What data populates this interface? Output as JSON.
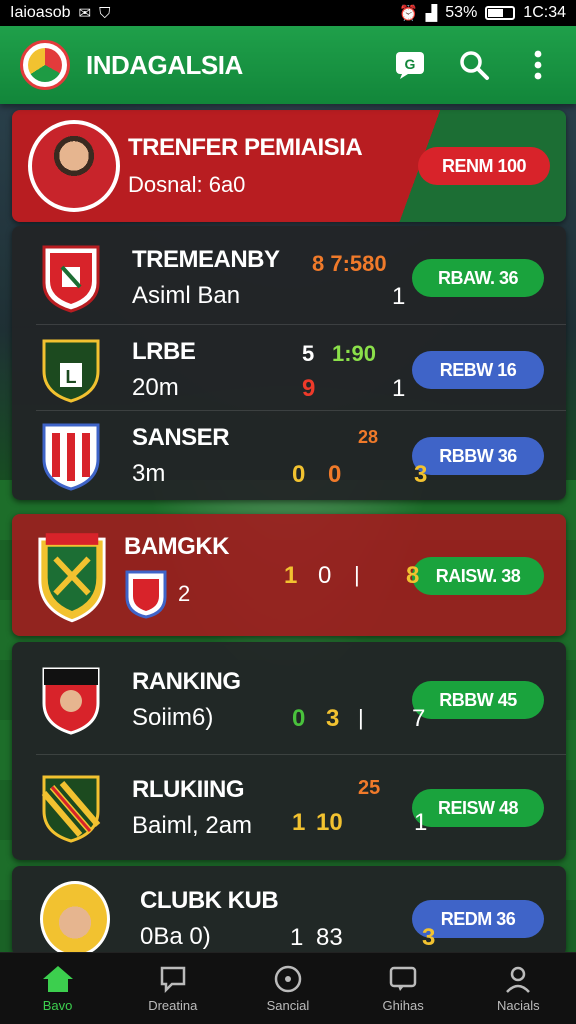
{
  "status_bar": {
    "carrier": "Iaioasob",
    "battery": "53%",
    "time": "1C:34"
  },
  "app_bar": {
    "title": "INDAGALSIA"
  },
  "featured": {
    "title": "TRENFER PEMIAISIA",
    "subtitle": "Dosnal: 6a0",
    "button": "RENM 100"
  },
  "group1": [
    {
      "name": "TREMEANBY",
      "sub": "Asiml Ban",
      "s1": "8 7:580",
      "s2": "1",
      "button": "RBAW. 36"
    },
    {
      "name": "LRBE",
      "sub": "20m",
      "s1": "5",
      "s2": "1:90",
      "s3": "9",
      "s4": "1",
      "button": "REBW 16"
    },
    {
      "name": "SANSER",
      "sub": "3m",
      "s1": "0",
      "s2": "0",
      "s3": "28",
      "s4": "3",
      "button": "RBBW 36"
    }
  ],
  "highlight": {
    "name": "BAMGKK",
    "s1": "1",
    "s2": "0",
    "s3": "|",
    "s4": "8",
    "extra": "2",
    "button": "RAISW. 38"
  },
  "group2": [
    {
      "name": "RANKING",
      "sub": "Soiim6)",
      "s1": "0",
      "s2": "3",
      "s3": "|",
      "s4": "7",
      "button": "RBBW 45"
    },
    {
      "name": "RLUKIING",
      "sub": "Baiml, 2am",
      "s1": "1",
      "s2": "10",
      "s3": "25",
      "s4": "1",
      "button": "REISW 48"
    }
  ],
  "club": {
    "name": "CLUBK KUB",
    "sub": "0Ba 0)",
    "s1": "1",
    "s2": "83",
    "s3": "3",
    "button": "REDM 36"
  },
  "nav": [
    "Bavo",
    "Dreatina",
    "Sancial",
    "Ghihas",
    "Nacials"
  ],
  "colors": {
    "accent": "#1fa04a",
    "red": "#d8232a",
    "blue": "#3f64c8"
  }
}
